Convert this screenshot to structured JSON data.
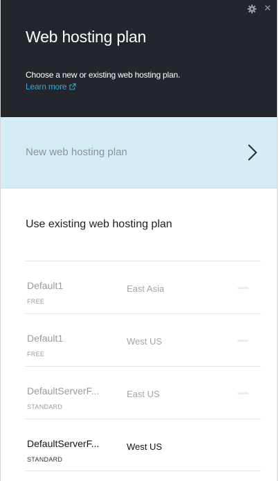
{
  "header": {
    "title": "Web hosting plan",
    "description": "Choose a new or existing web hosting plan.",
    "learn_more": "Learn more"
  },
  "new_plan": {
    "label": "New web hosting plan"
  },
  "existing": {
    "title": "Use existing web hosting plan",
    "plans": [
      {
        "name": "Default1",
        "tier": "FREE",
        "region": "East Asia",
        "enabled": false
      },
      {
        "name": "Default1",
        "tier": "FREE",
        "region": "West US",
        "enabled": false
      },
      {
        "name": "DefaultServerF...",
        "tier": "STANDARD",
        "region": "East US",
        "enabled": false
      },
      {
        "name": "DefaultServerF...",
        "tier": "STANDARD",
        "region": "West US",
        "enabled": true
      }
    ]
  },
  "colors": {
    "header_bg": "#23272d",
    "link": "#33a8e3",
    "selected_row_bg": "#d3ecf6"
  },
  "icons": {
    "settings": "gear-icon",
    "close": "close-icon",
    "external_link": "external-link-icon",
    "navigate": "chevron-right-icon"
  }
}
